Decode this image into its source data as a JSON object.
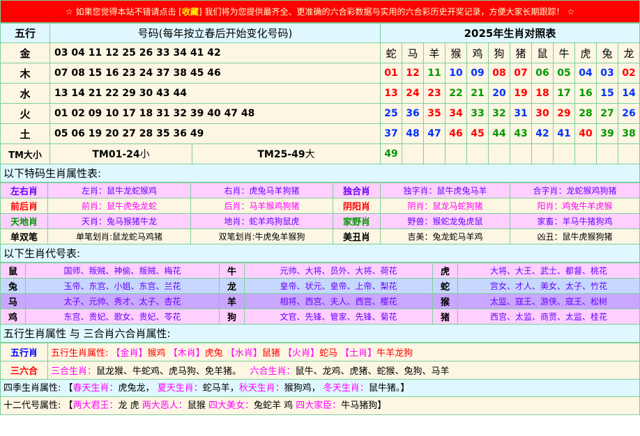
{
  "banner": {
    "pre": "☆ 如果您觉得本站不错请点击 [",
    "fav": "收藏",
    "post": "] 我们将为您提供最齐全、更准确的六合彩数据与实用的六合彩历史开奖记录，方便大家长期跟踪！ ☆"
  },
  "wuxing": {
    "head": {
      "col1": "五行",
      "col2": "号码(每年按立春后开始变化号码)",
      "col3": "2025年生肖对照表"
    },
    "animals": [
      "蛇",
      "马",
      "羊",
      "猴",
      "鸡",
      "狗",
      "猪",
      "鼠",
      "牛",
      "虎",
      "兔",
      "龙"
    ],
    "rows": [
      {
        "el": "金",
        "nums": "03 04 11 12 25 26 33 34 41 42",
        "cells": []
      },
      {
        "el": "木",
        "nums": "07 08 15 16 23 24 37 38 45 46",
        "cells": [
          {
            "v": "01",
            "c": "red"
          },
          {
            "v": "12",
            "c": "red"
          },
          {
            "v": "11",
            "c": "grn"
          },
          {
            "v": "10",
            "c": "blu"
          },
          {
            "v": "09",
            "c": "blu"
          },
          {
            "v": "08",
            "c": "red"
          },
          {
            "v": "07",
            "c": "red"
          },
          {
            "v": "06",
            "c": "grn"
          },
          {
            "v": "05",
            "c": "grn"
          },
          {
            "v": "04",
            "c": "blu"
          },
          {
            "v": "03",
            "c": "blu"
          },
          {
            "v": "02",
            "c": "red"
          }
        ]
      },
      {
        "el": "水",
        "nums": "13 14 21 22 29 30 43 44",
        "cells": [
          {
            "v": "13",
            "c": "red"
          },
          {
            "v": "24",
            "c": "red"
          },
          {
            "v": "23",
            "c": "red"
          },
          {
            "v": "22",
            "c": "grn"
          },
          {
            "v": "21",
            "c": "grn"
          },
          {
            "v": "20",
            "c": "blu"
          },
          {
            "v": "19",
            "c": "red"
          },
          {
            "v": "18",
            "c": "red"
          },
          {
            "v": "17",
            "c": "grn"
          },
          {
            "v": "16",
            "c": "grn"
          },
          {
            "v": "15",
            "c": "blu"
          },
          {
            "v": "14",
            "c": "blu"
          }
        ]
      },
      {
        "el": "火",
        "nums": "01 02 09 10 17 18 31 32 39 40 47 48",
        "cells": [
          {
            "v": "25",
            "c": "blu"
          },
          {
            "v": "36",
            "c": "blu"
          },
          {
            "v": "35",
            "c": "red"
          },
          {
            "v": "34",
            "c": "red"
          },
          {
            "v": "33",
            "c": "grn"
          },
          {
            "v": "32",
            "c": "grn"
          },
          {
            "v": "31",
            "c": "blu"
          },
          {
            "v": "30",
            "c": "red"
          },
          {
            "v": "29",
            "c": "red"
          },
          {
            "v": "28",
            "c": "grn"
          },
          {
            "v": "27",
            "c": "grn"
          },
          {
            "v": "26",
            "c": "blu"
          }
        ]
      },
      {
        "el": "土",
        "nums": "05 06 19 20 27 28 35 36 49",
        "cells": [
          {
            "v": "37",
            "c": "blu"
          },
          {
            "v": "48",
            "c": "blu"
          },
          {
            "v": "47",
            "c": "blu"
          },
          {
            "v": "46",
            "c": "red"
          },
          {
            "v": "45",
            "c": "red"
          },
          {
            "v": "44",
            "c": "grn"
          },
          {
            "v": "43",
            "c": "grn"
          },
          {
            "v": "42",
            "c": "blu"
          },
          {
            "v": "41",
            "c": "blu"
          },
          {
            "v": "40",
            "c": "red"
          },
          {
            "v": "39",
            "c": "grn"
          },
          {
            "v": "38",
            "c": "grn"
          }
        ]
      }
    ],
    "tm": {
      "label": "TM大小",
      "small_b": "TM01-24",
      "small_s": "小",
      "big_b": "TM25-49",
      "big_s": "大",
      "extra": "49"
    }
  },
  "attr": {
    "title": "以下特码生肖属性表:",
    "rows": [
      {
        "k1": "左右肖",
        "a": "左肖：鼠牛龙蛇猴鸡",
        "b": "右肖：虎兔马羊狗猪",
        "k2": "独合肖",
        "c": "独字肖：鼠牛虎兔马羊",
        "d": "合字肖：龙蛇猴鸡狗猪"
      },
      {
        "k1": "前后肖",
        "a": "前肖：鼠牛虎兔龙蛇",
        "b": "后肖：马羊猴鸡狗猪",
        "k2": "阴阳肖",
        "c": "阴肖：鼠龙马蛇狗猪",
        "d": "阳肖：鸡兔牛羊虎猴"
      },
      {
        "k1": "天地肖",
        "a": "天肖：兔马猴猪牛龙",
        "b": "地肖：蛇羊鸡狗鼠虎",
        "k2": "家野肖",
        "c": "野兽：猴蛇龙兔虎鼠",
        "d": "家畜：羊马牛猪狗鸡"
      },
      {
        "k1": "单双笔",
        "a": "单笔划肖:鼠龙蛇马鸡猪",
        "b": "双笔划肖:牛虎兔羊猴狗",
        "k2": "美丑肖",
        "c": "吉美：兔龙蛇马羊鸡",
        "d": "凶丑：鼠牛虎猴狗猪"
      }
    ]
  },
  "code": {
    "title": "以下生肖代号表:",
    "rows": [
      [
        {
          "z": "鼠",
          "t": "国师、叛贼、神偷、叛贼、梅花"
        },
        {
          "z": "牛",
          "t": "元帅、大将、员外、大将、荷花"
        },
        {
          "z": "虎",
          "t": "大将、大王、武士、都督、桃花"
        }
      ],
      [
        {
          "z": "兔",
          "t": "玉帝、东宫、小姐、东宫、兰花"
        },
        {
          "z": "龙",
          "t": "皇帝、状元、皇帝、上帝、梨花"
        },
        {
          "z": "蛇",
          "t": "宫女、才人、美女、太子、竹花"
        }
      ],
      [
        {
          "z": "马",
          "t": "太子、元帅、秀才、太子、杏花"
        },
        {
          "z": "羊",
          "t": "相将、西宫、夫人、西宫、樱花"
        },
        {
          "z": "猴",
          "t": "太监、寇王、游侠、寇王、松树"
        }
      ],
      [
        {
          "z": "鸡",
          "t": "东宫、贵妃、歌女、贵妃、苓花"
        },
        {
          "z": "狗",
          "t": "文官、先锋、管家、先锋、菊花"
        },
        {
          "z": "猪",
          "t": "西宫、太监、商贾、太监、桂花"
        }
      ]
    ]
  },
  "wx": {
    "title": "五行生肖属性 与 三合肖六合肖属性:",
    "r1_k": "五行肖",
    "r1_lead": "五行生肖属性:",
    "r1_items": [
      {
        "b": "【金肖】",
        "v": "猴鸡 "
      },
      {
        "b": "【木肖】",
        "v": "虎兔 "
      },
      {
        "b": "【水肖】",
        "v": "鼠猪 "
      },
      {
        "b": "【火肖】",
        "v": "蛇马 "
      },
      {
        "b": "【土肖】",
        "v": "牛羊龙狗"
      }
    ],
    "r2_k": "三六合",
    "r2_a": "三合生肖：",
    "r2_av": "鼠龙猴、牛蛇鸡、虎马狗、免羊猪。",
    "r2_b": "六合生肖：",
    "r2_bv": "鼠牛、龙鸡、虎猪、蛇猴、兔狗、马羊"
  },
  "season": {
    "lead": "四季生肖属性: 【",
    "s1": "春天生肖：",
    "v1": "虎兔龙，",
    "s2": "夏天生肖：",
    "v2": "蛇马羊，",
    "s3": "秋天生肖：",
    "v3": "猴狗鸡，",
    "s4": "冬天生肖：",
    "v4": "鼠牛猪。",
    "end": "】"
  },
  "twelve": {
    "lead": "十二代号属性: 【",
    "s1": "两大君王：",
    "v1": "龙 虎 ",
    "s2": "两大恶人：",
    "v2": "鼠猴 ",
    "s3": "四大美女：",
    "v3": "兔蛇羊 鸡 ",
    "s4": "四大家臣：",
    "v4": "牛马猪狗】"
  }
}
